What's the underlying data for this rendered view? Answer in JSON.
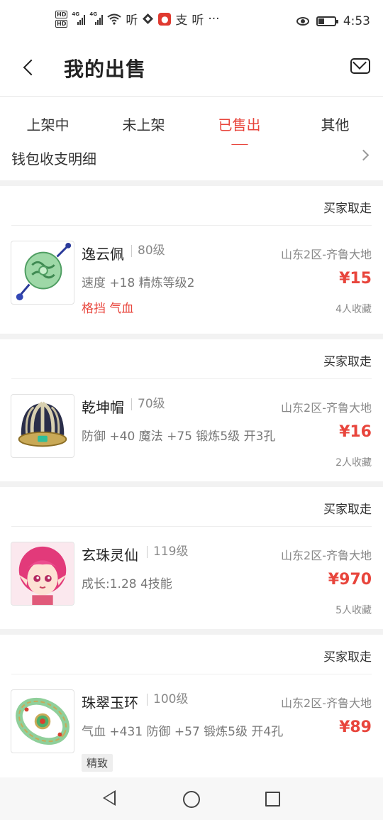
{
  "status_bar": {
    "hd1": "HD",
    "hd2": "HD",
    "net1": "4G",
    "net2": "4G",
    "app_text1": "听",
    "app_text2": "支",
    "app_text3": "听",
    "more": "···",
    "time": "4:53",
    "battery_level": 0.35
  },
  "header": {
    "title": "我的出售"
  },
  "tabs": [
    {
      "label": "上架中",
      "active": false
    },
    {
      "label": "未上架",
      "active": false
    },
    {
      "label": "已售出",
      "active": true
    },
    {
      "label": "其他",
      "active": false
    }
  ],
  "wallet": {
    "label": "钱包收支明细"
  },
  "items": [
    {
      "status": "买家取走",
      "name": "逸云佩",
      "level": "80级",
      "server": "山东2区-齐鲁大地",
      "desc": "速度 +18 精炼等级2",
      "price": "¥15",
      "tags": "格挡 气血",
      "favs": "4人收藏",
      "icon": "jade-pendant-icon"
    },
    {
      "status": "买家取走",
      "name": "乾坤帽",
      "level": "70级",
      "server": "山东2区-齐鲁大地",
      "desc": "防御 +40 魔法 +75 锻炼5级 开3孔",
      "price": "¥16",
      "favs": "2人收藏",
      "icon": "helmet-icon"
    },
    {
      "status": "买家取走",
      "name": "玄珠灵仙",
      "level": "119级",
      "server": "山东2区-齐鲁大地",
      "desc": "成长:1.28 4技能",
      "price": "¥970",
      "favs": "5人收藏",
      "icon": "fairy-pet-icon"
    },
    {
      "status": "买家取走",
      "name": "珠翠玉环",
      "level": "100级",
      "server": "山东2区-齐鲁大地",
      "desc": "气血 +431 防御 +57 锻炼5级 开4孔",
      "price": "¥89",
      "chip": "精致",
      "icon": "jade-ring-icon"
    }
  ],
  "colors": {
    "accent": "#e8453c",
    "muted": "#888888",
    "band": "#f2f2f2"
  }
}
